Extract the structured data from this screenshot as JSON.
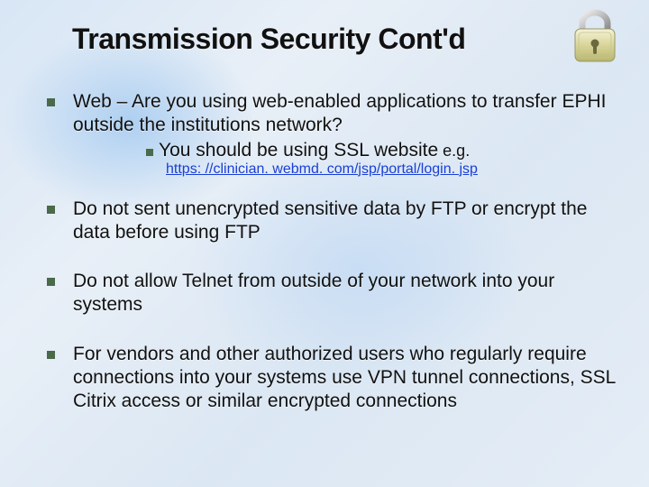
{
  "title": "Transmission Security Cont'd",
  "bullets": {
    "b1": "Web – Are you using web-enabled applications to transfer EPHI outside the institutions network?",
    "b1_sub": "You should be using SSL website",
    "b1_eg": " e.g.",
    "b1_link": "https: //clinician. webmd. com/jsp/portal/login. jsp",
    "b2": "Do not sent unencrypted sensitive data by FTP or encrypt the data before using FTP",
    "b3": "Do not allow Telnet from outside of your network into your systems",
    "b4": "For vendors and other authorized users who regularly require connections into your systems use VPN tunnel connections, SSL Citrix access or similar encrypted connections"
  }
}
